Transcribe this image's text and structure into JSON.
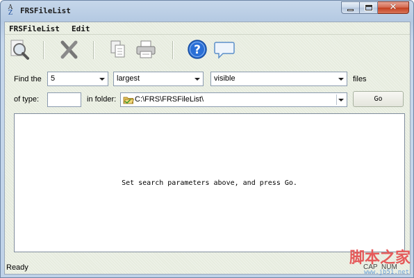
{
  "window": {
    "title": "FRSFileList",
    "icon_letters": [
      "A",
      "Z"
    ]
  },
  "menu": {
    "items": [
      {
        "label": "FRSFileList"
      },
      {
        "label": "Edit"
      }
    ]
  },
  "toolbar": {
    "buttons": [
      {
        "icon": "search-icon"
      },
      {
        "icon": "delete-icon"
      },
      {
        "icon": "copy-icon"
      },
      {
        "icon": "print-icon"
      },
      {
        "icon": "help-icon"
      },
      {
        "icon": "comment-icon"
      }
    ]
  },
  "search": {
    "find_label": "Find the",
    "count_value": "5",
    "order_value": "largest",
    "visibility_value": "visible",
    "files_label": "files",
    "type_label": "of type:",
    "type_value": "",
    "folder_label": "in folder:",
    "folder_value": "C:\\FRS\\FRSFileList\\",
    "go_label": "Go"
  },
  "results": {
    "message": "Set search parameters above, and press Go."
  },
  "status": {
    "text": "Ready",
    "caps": "CAP",
    "num": "NUM"
  },
  "watermark": {
    "text": "脚本之家",
    "url": "www.jb51.net"
  },
  "colors": {
    "client_bg": "#e7ecdf",
    "help_icon": "#2a6fd6",
    "close_button": "#c3401f"
  }
}
